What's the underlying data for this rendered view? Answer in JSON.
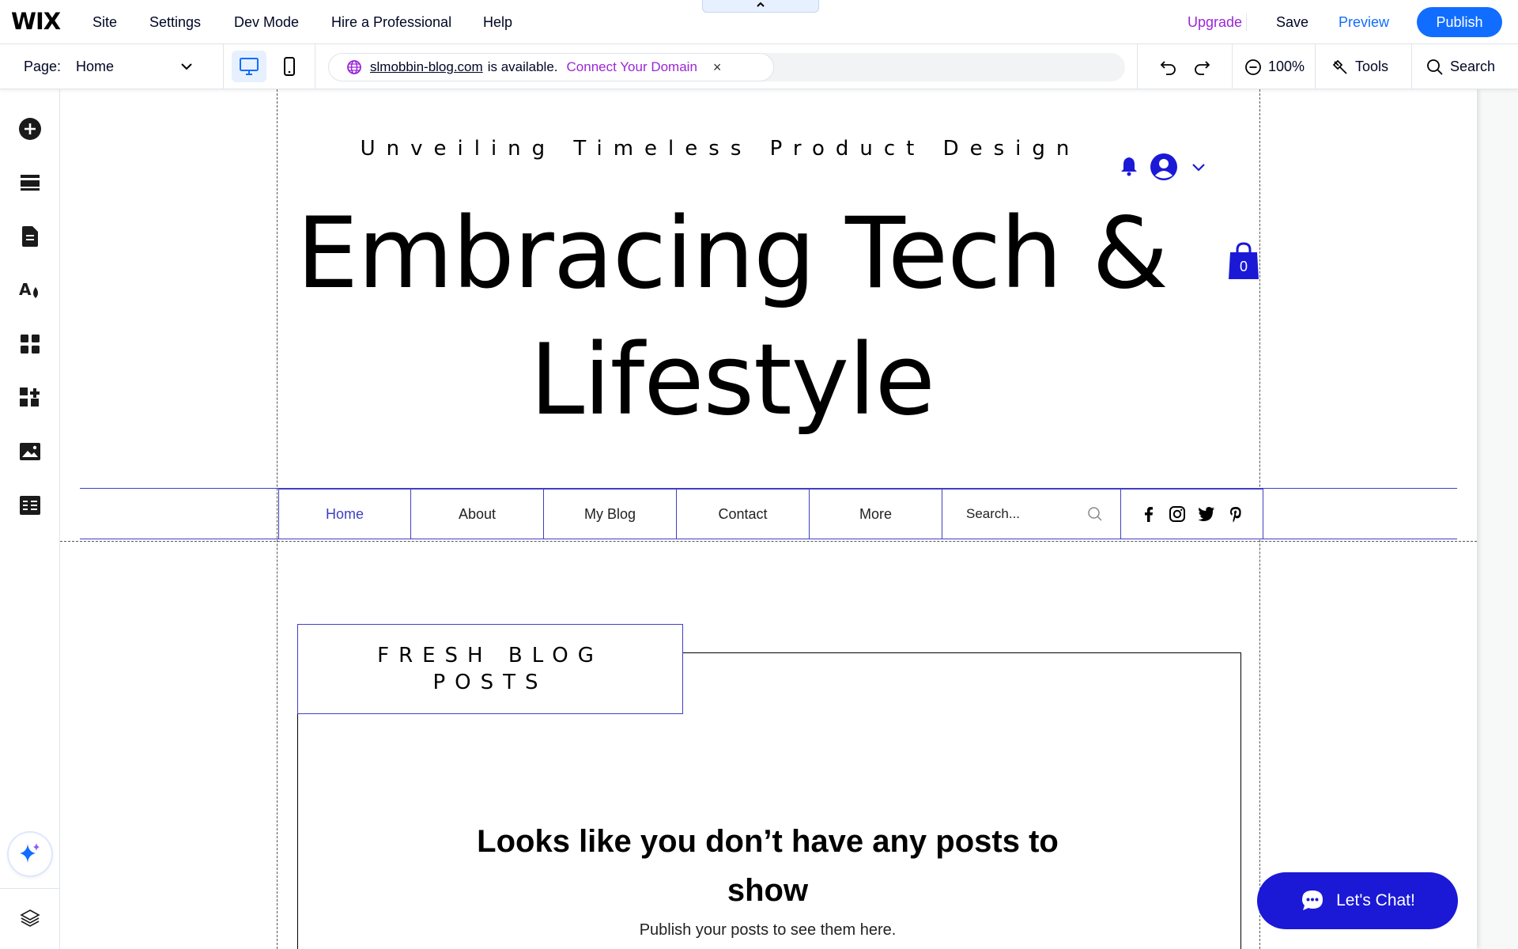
{
  "topbar": {
    "logo": "WIX",
    "menu": [
      "Site",
      "Settings",
      "Dev Mode",
      "Hire a Professional",
      "Help"
    ],
    "upgrade": "Upgrade",
    "save": "Save",
    "preview": "Preview",
    "publish": "Publish"
  },
  "toolbar": {
    "page_label": "Page:",
    "page_value": "Home",
    "domain_name": "slmobbin-blog.com",
    "domain_status": "is available.",
    "connect": "Connect Your Domain",
    "close": "×",
    "zoom": "100%",
    "tools": "Tools",
    "search": "Search"
  },
  "site": {
    "tagline": "Unveiling Timeless Product Design",
    "hero_line1": "Embracing Tech &",
    "hero_line2": "Lifestyle",
    "cart_count": "0",
    "nav": [
      "Home",
      "About",
      "My Blog",
      "Contact",
      "More"
    ],
    "nav_active": "Home",
    "search_placeholder": "Search...",
    "fresh_line1": "FRESH BLOG",
    "fresh_line2": "POSTS",
    "empty_title": "Looks like you don’t have any posts to show",
    "empty_sub": "Publish your posts to see them here.",
    "chat": "Let's Chat!"
  },
  "icons": {
    "sidebar": [
      "add-icon",
      "sections-icon",
      "pages-icon",
      "design-icon",
      "apps-icon",
      "business-icon",
      "media-icon",
      "cms-icon",
      "ai-assistant-icon",
      "layers-icon"
    ],
    "social": [
      "facebook-icon",
      "instagram-icon",
      "twitter-icon",
      "pinterest-icon"
    ]
  },
  "colors": {
    "wix_blue": "#116dff",
    "upgrade_purple": "#9a27d5",
    "site_accent": "#3f3fc4",
    "chat_blue": "#1b19d6"
  }
}
